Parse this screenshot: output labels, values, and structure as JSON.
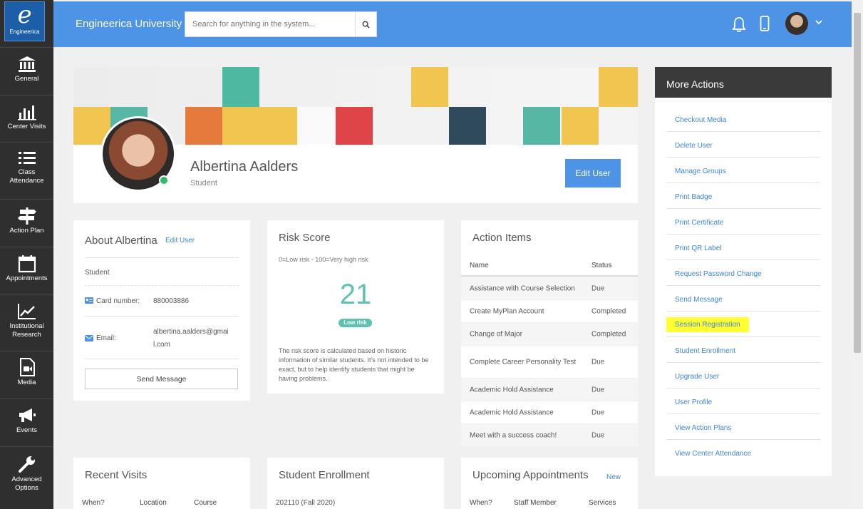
{
  "sidebar": {
    "logo_letter": "e",
    "logo_text": "Engineerica",
    "items": [
      {
        "label": "General"
      },
      {
        "label": "Center Visits"
      },
      {
        "label": "Class Attendance"
      },
      {
        "label": "Action Plan"
      },
      {
        "label": "Appointments"
      },
      {
        "label": "Institutional Research"
      },
      {
        "label": "Media"
      },
      {
        "label": "Events"
      },
      {
        "label": "Advanced Options"
      }
    ]
  },
  "topbar": {
    "brand": "Engineerica University",
    "search_placeholder": "Search for anything in the system..."
  },
  "profile": {
    "name": "Albertina Aalders",
    "role": "Student",
    "edit_label": "Edit User"
  },
  "about": {
    "title": "About Albertina",
    "edit_link": "Edit User",
    "role": "Student",
    "card_label": "Card number:",
    "card_value": "880003886",
    "email_label": "Email:",
    "email_value_1": "albertina.aalders@gmai",
    "email_value_2": "l.com",
    "send_label": "Send Message"
  },
  "risk": {
    "title": "Risk Score",
    "scale": "0=Low risk - 100=Very high risk",
    "score": "21",
    "badge": "Low risk",
    "description": "The risk score is calculated based on historic information of similar students. It's not intended to be exact, but to help identify students that might be having problems."
  },
  "action_items": {
    "title": "Action Items",
    "col_name": "Name",
    "col_status": "Status",
    "rows": [
      {
        "name": "Assistance with Course Selection",
        "status": "Due"
      },
      {
        "name": "Create MyPlan Account",
        "status": "Completed"
      },
      {
        "name": "Change of Major",
        "status": "Completed"
      },
      {
        "name": "Complete Career Personality Test",
        "status": "Due"
      },
      {
        "name": "Academic Hold Assistance",
        "status": "Due"
      },
      {
        "name": "Academic Hold Assistance",
        "status": "Due"
      },
      {
        "name": "Meet with a success coach!",
        "status": "Due"
      }
    ]
  },
  "more_actions": {
    "title": "More Actions",
    "items": [
      "Checkout Media",
      "Delete User",
      "Manage Groups",
      "Print Badge",
      "Print Certificate",
      "Print QR Label",
      "Request Password Change",
      "Send Message",
      "Session Registration",
      "Student Enrollment",
      "Upgrade User",
      "User Profile",
      "View Action Plans",
      "View Center Attendance"
    ]
  },
  "recent_visits": {
    "title": "Recent Visits",
    "cols": [
      "When?",
      "Location",
      "Course"
    ]
  },
  "student_enrollment": {
    "title": "Student Enrollment",
    "first_row": "202110 (Fall 2020)"
  },
  "upcoming_appointments": {
    "title": "Upcoming Appointments",
    "new_link": "New",
    "cols": [
      "When?",
      "Staff Member",
      "Services"
    ]
  },
  "colors": {
    "primary": "#4d94e6",
    "sidebar": "#2f2f2f",
    "risk": "#5fc1b0",
    "highlight": "#ffff33",
    "link": "#3d86d6"
  }
}
